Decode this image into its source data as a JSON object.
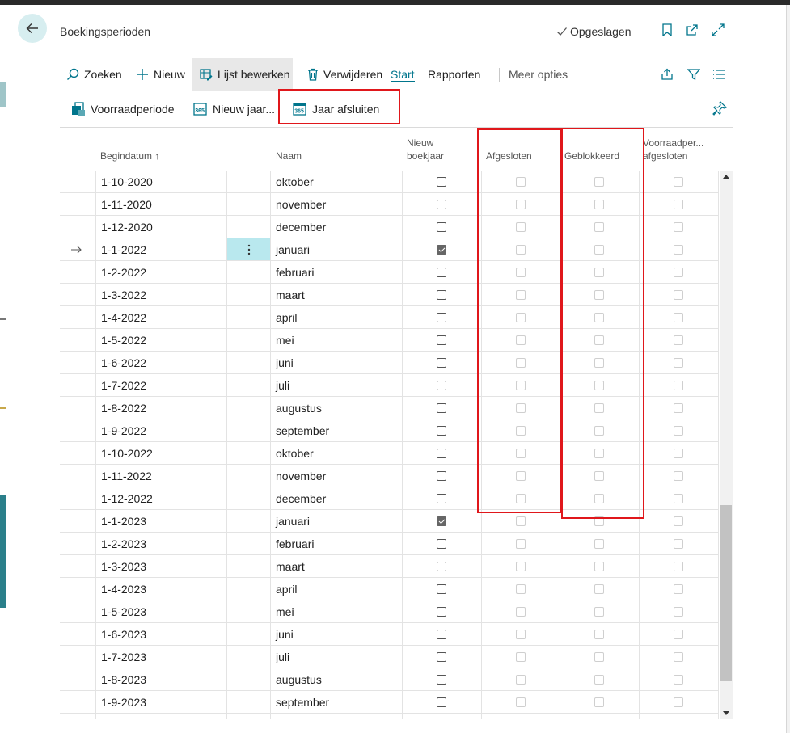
{
  "header": {
    "title": "Boekingsperioden",
    "saved_label": "Opgeslagen"
  },
  "actions": {
    "search": "Zoeken",
    "new": "Nieuw",
    "edit_list": "Lijst bewerken",
    "delete": "Verwijderen",
    "start": "Start",
    "reports": "Rapporten",
    "more": "Meer opties"
  },
  "subactions": {
    "inventory_period": "Voorraadperiode",
    "new_year": "Nieuw jaar...",
    "close_year": "Jaar afsluiten"
  },
  "columns": {
    "start_date": "Begindatum ↑",
    "name": "Naam",
    "new_fiscal_year_1": "Nieuw",
    "new_fiscal_year_2": "boekjaar",
    "closed": "Afgesloten",
    "locked": "Geblokkeerd",
    "inv_closed_1": "Voorraadper...",
    "inv_closed_2": "afgesloten"
  },
  "rows": [
    {
      "date": "1-10-2020",
      "name": "oktober",
      "new_year": false
    },
    {
      "date": "1-11-2020",
      "name": "november",
      "new_year": false
    },
    {
      "date": "1-12-2020",
      "name": "december",
      "new_year": false
    },
    {
      "date": "1-1-2022",
      "name": "januari",
      "new_year": true,
      "current": true
    },
    {
      "date": "1-2-2022",
      "name": "februari",
      "new_year": false
    },
    {
      "date": "1-3-2022",
      "name": "maart",
      "new_year": false
    },
    {
      "date": "1-4-2022",
      "name": "april",
      "new_year": false
    },
    {
      "date": "1-5-2022",
      "name": "mei",
      "new_year": false
    },
    {
      "date": "1-6-2022",
      "name": "juni",
      "new_year": false
    },
    {
      "date": "1-7-2022",
      "name": "juli",
      "new_year": false
    },
    {
      "date": "1-8-2022",
      "name": "augustus",
      "new_year": false
    },
    {
      "date": "1-9-2022",
      "name": "september",
      "new_year": false
    },
    {
      "date": "1-10-2022",
      "name": "oktober",
      "new_year": false
    },
    {
      "date": "1-11-2022",
      "name": "november",
      "new_year": false
    },
    {
      "date": "1-12-2022",
      "name": "december",
      "new_year": false
    },
    {
      "date": "1-1-2023",
      "name": "januari",
      "new_year": true
    },
    {
      "date": "1-2-2023",
      "name": "februari",
      "new_year": false
    },
    {
      "date": "1-3-2023",
      "name": "maart",
      "new_year": false
    },
    {
      "date": "1-4-2023",
      "name": "april",
      "new_year": false
    },
    {
      "date": "1-5-2023",
      "name": "mei",
      "new_year": false
    },
    {
      "date": "1-6-2023",
      "name": "juni",
      "new_year": false
    },
    {
      "date": "1-7-2023",
      "name": "juli",
      "new_year": false
    },
    {
      "date": "1-8-2023",
      "name": "augustus",
      "new_year": false
    },
    {
      "date": "1-9-2023",
      "name": "september",
      "new_year": false
    }
  ],
  "colors": {
    "accent": "#00758c",
    "highlight_box": "#e0171b",
    "row_menu_bg": "#b9e8ee"
  }
}
